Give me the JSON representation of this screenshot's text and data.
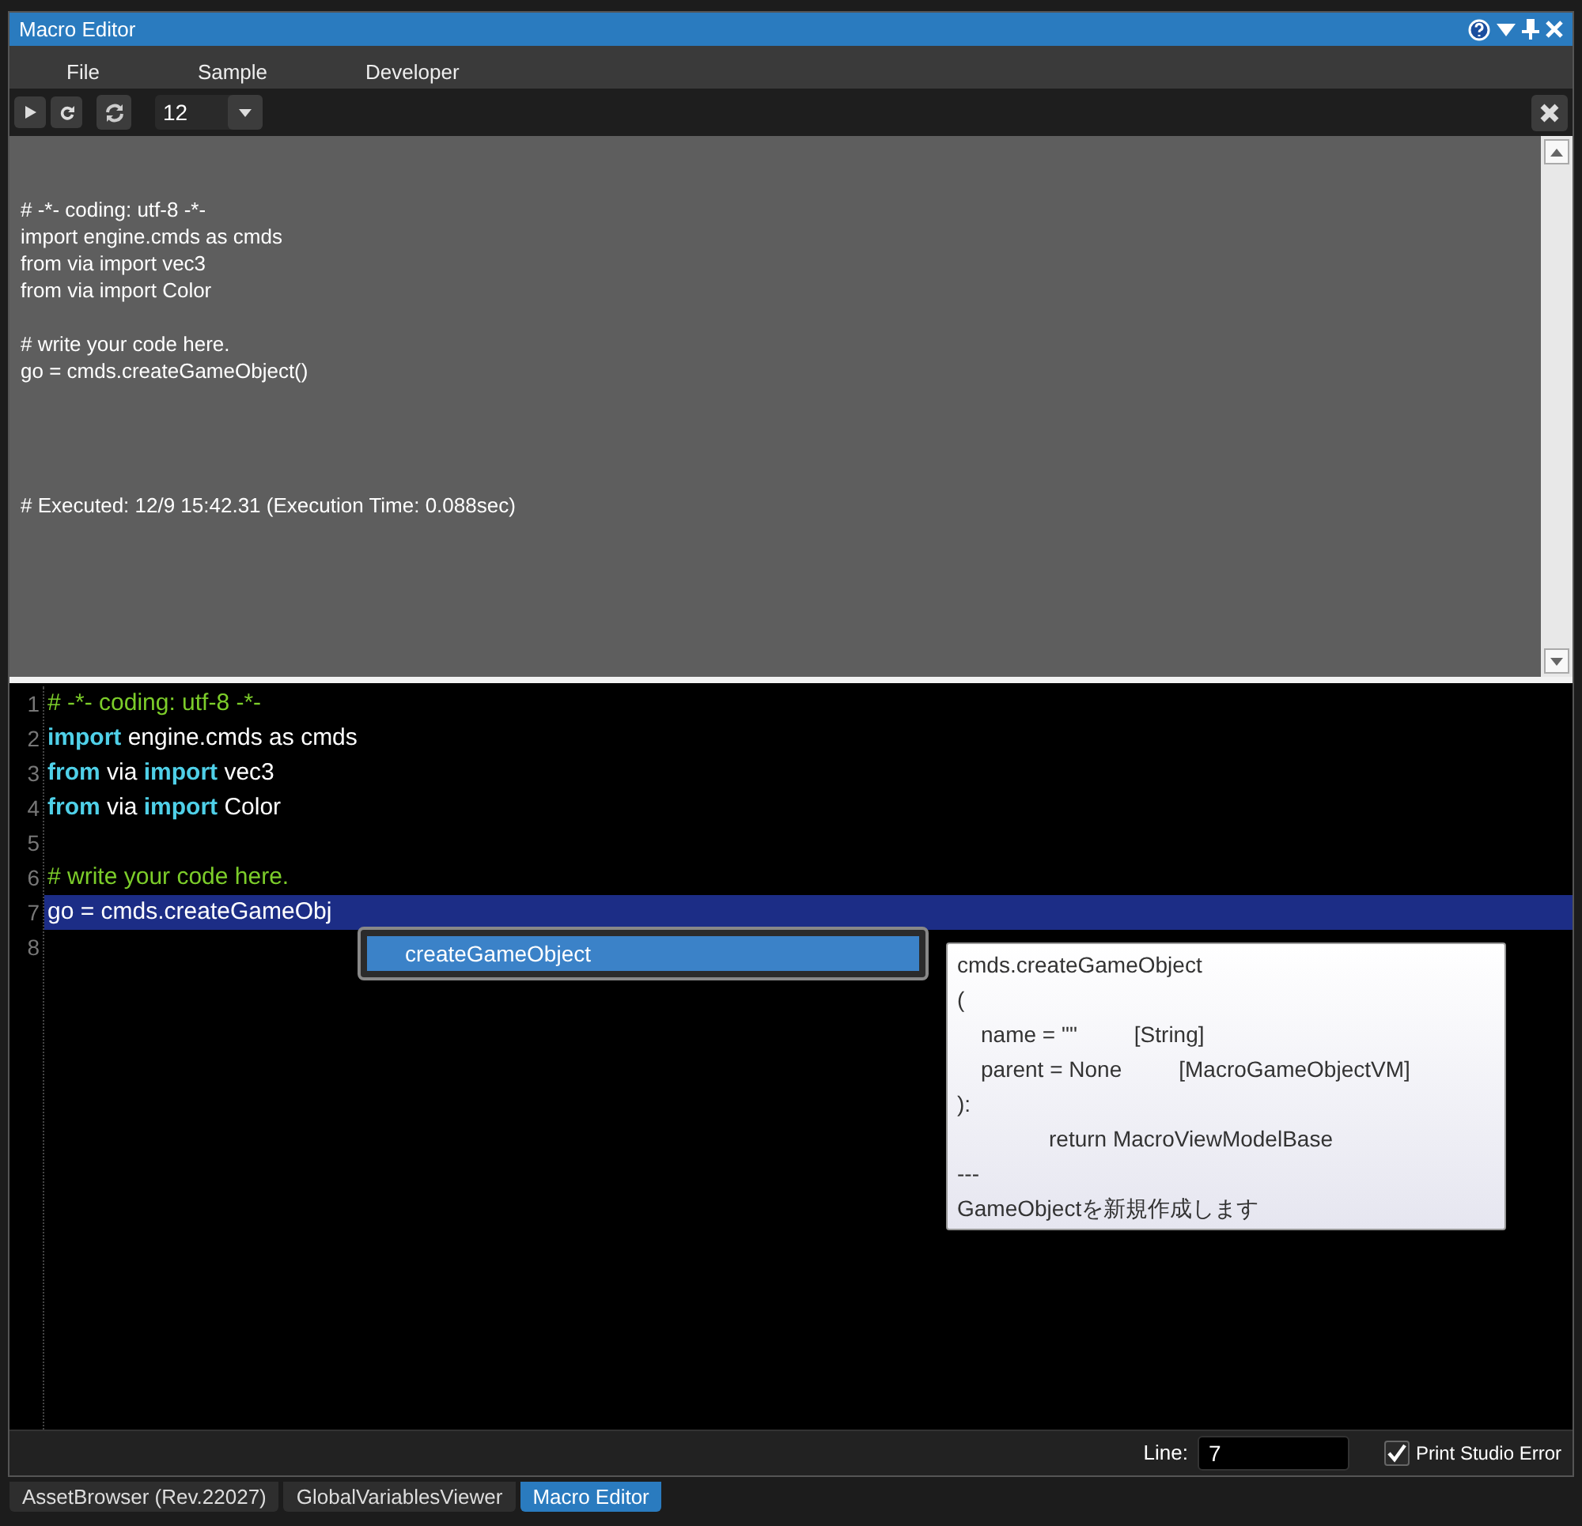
{
  "window": {
    "title": "Macro Editor"
  },
  "menu": [
    "File",
    "Sample",
    "Developer"
  ],
  "toolbar": {
    "count": "12"
  },
  "output": {
    "blocks": [
      [
        "# -*- coding: utf-8 -*-",
        "import engine.cmds as cmds",
        "from via import vec3",
        "from via import Color"
      ],
      [
        "# write your code here.",
        "go = cmds.createGameObject()"
      ],
      [
        "# Executed: 12/9 15:42.31 (Execution Time: 0.088sec)"
      ]
    ]
  },
  "editor": {
    "lines": [
      {
        "number": "1",
        "selected": false,
        "tokens": [
          {
            "kind": "comment",
            "text": "# -*- coding: utf-8 -*-"
          }
        ]
      },
      {
        "number": "2",
        "selected": false,
        "tokens": [
          {
            "kind": "keyword",
            "text": "import"
          },
          {
            "kind": "plain",
            "text": " engine.cmds as cmds"
          }
        ]
      },
      {
        "number": "3",
        "selected": false,
        "tokens": [
          {
            "kind": "keyword",
            "text": "from"
          },
          {
            "kind": "plain",
            "text": " via "
          },
          {
            "kind": "keyword",
            "text": "import"
          },
          {
            "kind": "plain",
            "text": " vec3"
          }
        ]
      },
      {
        "number": "4",
        "selected": false,
        "tokens": [
          {
            "kind": "keyword",
            "text": "from"
          },
          {
            "kind": "plain",
            "text": " via "
          },
          {
            "kind": "keyword",
            "text": "import"
          },
          {
            "kind": "plain",
            "text": " Color"
          }
        ]
      },
      {
        "number": "5",
        "selected": false
      },
      {
        "number": "6",
        "selected": false,
        "tokens": [
          {
            "kind": "comment",
            "text": "# write your code here."
          }
        ]
      },
      {
        "number": "7",
        "selected": true,
        "tokens": [
          {
            "kind": "plain",
            "text": "go = cmds.createGameObj"
          }
        ]
      },
      {
        "number": "8",
        "selected": false
      }
    ],
    "completion": [
      {
        "label": "createGameObject",
        "selected": true
      }
    ],
    "tooltip": [
      {
        "kind": "text",
        "text": "cmds.createGameObject"
      },
      {
        "kind": "text",
        "text": "("
      },
      {
        "kind": "param",
        "text": "name = \"\"",
        "type": "[String]"
      },
      {
        "kind": "param",
        "text": "parent = None",
        "type": "[MacroGameObjectVM]"
      },
      {
        "kind": "text",
        "text": "):"
      },
      {
        "kind": "return",
        "text": "return MacroViewModelBase"
      },
      {
        "kind": "text",
        "text": "---"
      },
      {
        "kind": "text",
        "text": "GameObjectを新規作成します"
      }
    ]
  },
  "status": {
    "line_label": "Line:",
    "line_value": "7",
    "print_error": {
      "label": "Print Studio Error",
      "checked": true
    }
  },
  "tabs": [
    {
      "label": "AssetBrowser (Rev.22027)",
      "selected": false
    },
    {
      "label": "GlobalVariablesViewer",
      "selected": false
    },
    {
      "label": "Macro Editor",
      "selected": true
    }
  ]
}
